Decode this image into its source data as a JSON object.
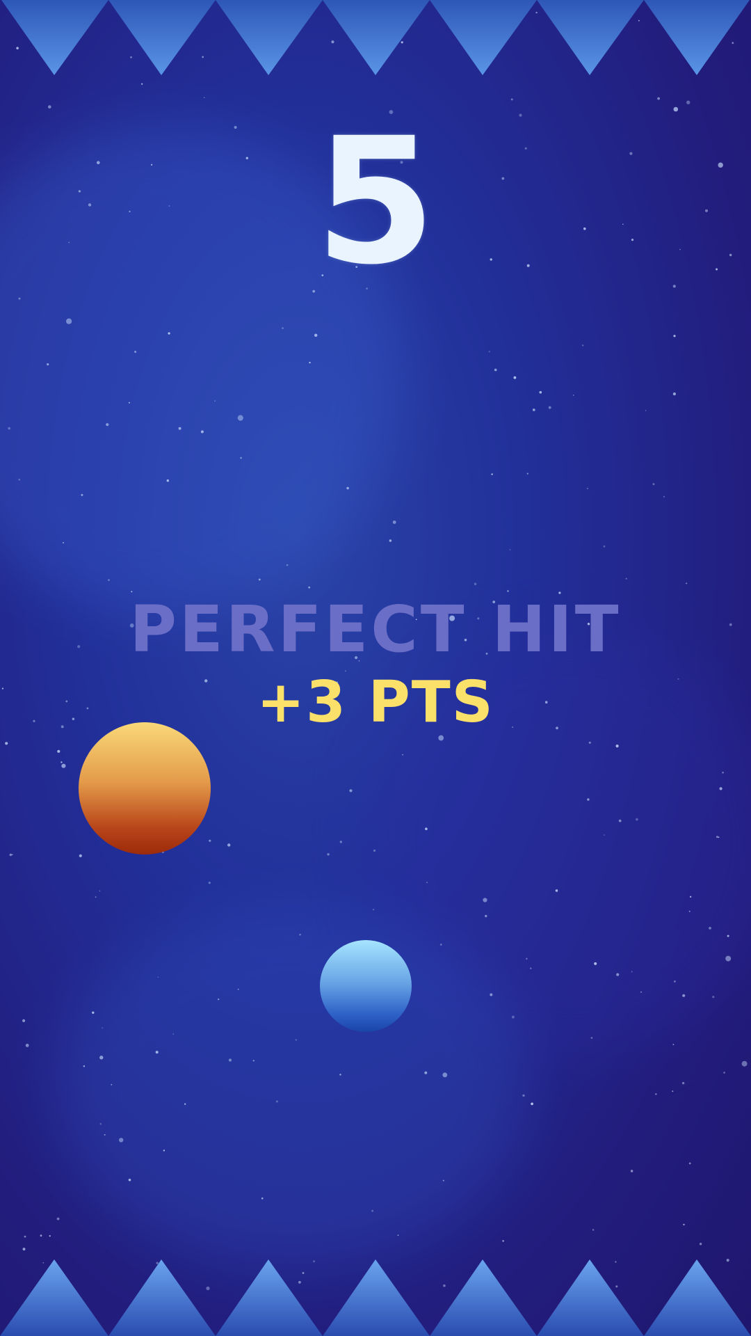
{
  "game": {
    "score": "5",
    "hit_message": "PERFECT HIT",
    "points_message": "+3 PTS"
  },
  "colors": {
    "background": "#221c7c",
    "spike": "#4d86dd",
    "score_text": "#e9f4ff",
    "hit_text": "#6a6ec6",
    "points_text": "#fbe06a",
    "orange_ball_top": "#f9d878",
    "orange_ball_bottom": "#9d2a0a",
    "blue_ball_top": "#a6e4ff",
    "blue_ball_bottom": "#1a44a8"
  },
  "icons": {
    "top_hazard": "spike-row-icon",
    "bottom_hazard": "spike-row-icon",
    "player": "blue-ball-icon",
    "target": "orange-ball-icon"
  }
}
